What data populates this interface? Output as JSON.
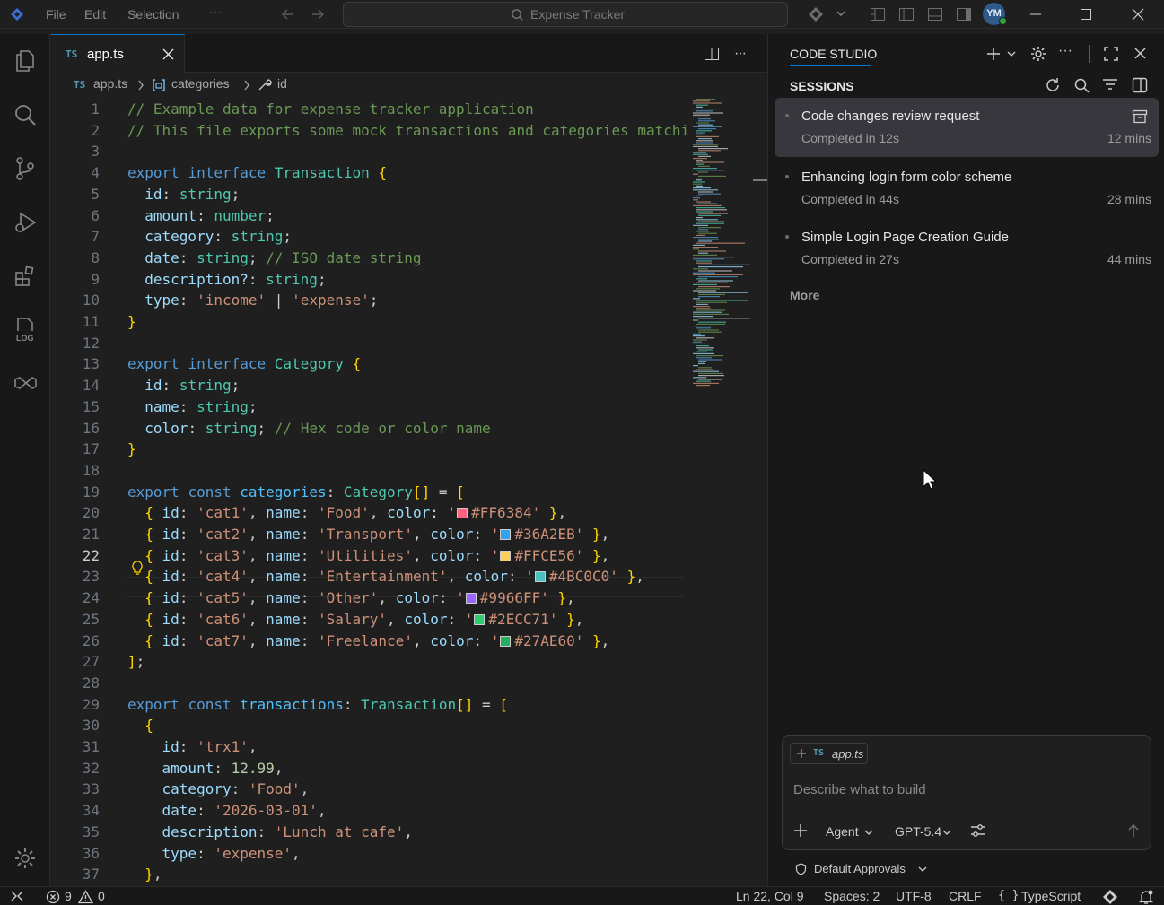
{
  "titlebar": {
    "menu": [
      "File",
      "Edit",
      "Selection",
      "···"
    ],
    "search_text": "Expense Tracker",
    "avatar_initials": "YM"
  },
  "editor": {
    "tab_lang": "TS",
    "tab_label": "app.ts",
    "breadcrumb": [
      "app.ts",
      "categories",
      "id"
    ],
    "current_line": 22,
    "swatch_colors": {
      "20": "#FF6384",
      "21": "#36A2EB",
      "22": "#FFCE56",
      "23": "#4BC0C0",
      "24": "#9966FF",
      "25": "#2ECC71",
      "26": "#27AE60"
    },
    "lines": [
      "// Example data for expense tracker application",
      "// This file exports some mock transactions and categories matchi",
      "",
      "export interface Transaction {",
      "  id: string;",
      "  amount: number;",
      "  category: string;",
      "  date: string; // ISO date string",
      "  description?: string;",
      "  type: 'income' | 'expense';",
      "}",
      "",
      "export interface Category {",
      "  id: string;",
      "  name: string;",
      "  color: string; // Hex code or color name",
      "}",
      "",
      "export const categories: Category[] = [",
      "  { id: 'cat1', name: 'Food', color: '#FF6384' },",
      "  { id: 'cat2', name: 'Transport', color: '#36A2EB' },",
      "  { id: 'cat3', name: 'Utilities', color: '#FFCE56' },",
      "  { id: 'cat4', name: 'Entertainment', color: '#4BC0C0' },",
      "  { id: 'cat5', name: 'Other', color: '#9966FF' },",
      "  { id: 'cat6', name: 'Salary', color: '#2ECC71' },",
      "  { id: 'cat7', name: 'Freelance', color: '#27AE60' },",
      "];",
      "",
      "export const transactions: Transaction[] = [",
      "  {",
      "    id: 'trx1',",
      "    amount: 12.99,",
      "    category: 'Food',",
      "    date: '2026-03-01',",
      "    description: 'Lunch at cafe',",
      "    type: 'expense',",
      "  },"
    ]
  },
  "panel": {
    "title": "CODE STUDIO",
    "sessions_header": "SESSIONS",
    "sessions": [
      {
        "title": "Code changes review request",
        "status": "Completed in 12s",
        "age": "12 mins"
      },
      {
        "title": "Enhancing login form color scheme",
        "status": "Completed in 44s",
        "age": "28 mins"
      },
      {
        "title": "Simple Login Page Creation Guide",
        "status": "Completed in 27s",
        "age": "44 mins"
      }
    ],
    "more_label": "More",
    "chat": {
      "context_lang": "TS",
      "context_file": "app.ts",
      "placeholder": "Describe what to build",
      "mode": "Agent",
      "model": "GPT-5.4"
    },
    "approvals_label": "Default Approvals"
  },
  "statusbar": {
    "errors": "9",
    "warnings": "0",
    "position": "Ln 22, Col 9",
    "spaces": "Spaces: 2",
    "encoding": "UTF-8",
    "eol": "CRLF",
    "language": "TypeScript",
    "lang_braces": "{ }"
  },
  "colors": {
    "accent": "#0078d4",
    "background": "#1f1f1f",
    "sidebar": "#181818"
  }
}
